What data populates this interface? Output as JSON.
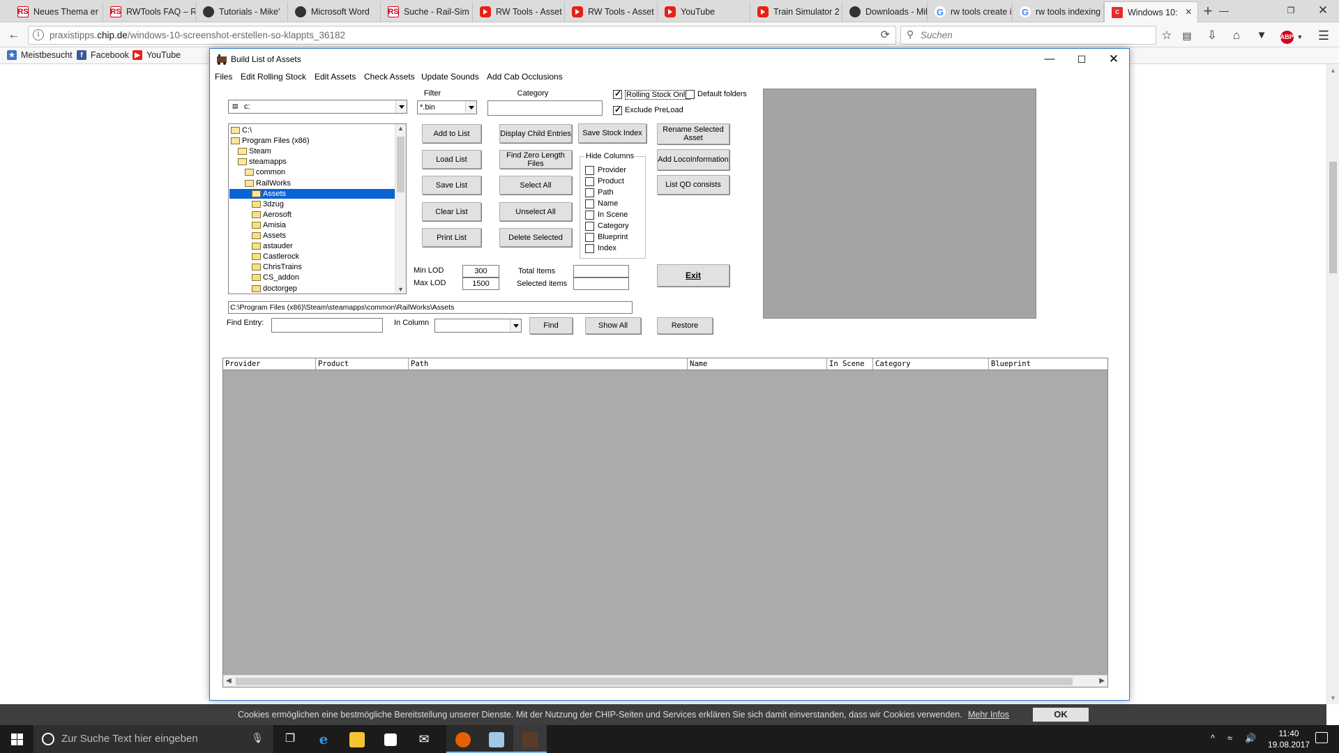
{
  "browser": {
    "tabs": [
      {
        "label": "Neues Thema er",
        "fav": "rs"
      },
      {
        "label": "RWTools FAQ – R",
        "fav": "rs"
      },
      {
        "label": "Tutorials - Mike'",
        "fav": "ns"
      },
      {
        "label": "Microsoft Word",
        "fav": "ns"
      },
      {
        "label": "Suche - Rail-Sim",
        "fav": "rs"
      },
      {
        "label": "RW Tools - Asset",
        "fav": "yt"
      },
      {
        "label": "RW Tools - Asset",
        "fav": "yt"
      },
      {
        "label": "YouTube",
        "fav": "yt"
      },
      {
        "label": "Train Simulator 2",
        "fav": "yt"
      },
      {
        "label": "Downloads - Mik",
        "fav": "ns"
      },
      {
        "label": "rw tools create in",
        "fav": "g"
      },
      {
        "label": "rw tools indexing",
        "fav": "g"
      },
      {
        "label": "Windows 10:",
        "fav": "win"
      }
    ],
    "url_prefix": "praxistipps.",
    "url_domain": "chip.de",
    "url_path": "/windows-10-screenshot-erstellen-so-klappts_36182",
    "search_placeholder": "Suchen",
    "bookmarks": [
      "Meistbesucht",
      "Facebook",
      "YouTube"
    ]
  },
  "cookie": {
    "text": "Cookies ermöglichen eine bestmögliche Bereitstellung unserer Dienste. Mit der Nutzung der CHIP-Seiten und Services erklären Sie sich damit einverstanden, dass wir Cookies verwenden.",
    "link": "Mehr Infos",
    "ok": "OK"
  },
  "taskbar": {
    "search_placeholder": "Zur Suche Text hier eingeben",
    "time": "11:40",
    "date": "19.08.2017"
  },
  "app": {
    "title": "Build List of Assets",
    "menu": [
      "Files",
      "Edit Rolling Stock",
      "Edit Assets",
      "Check Assets",
      "Update Sounds",
      "Add Cab Occlusions"
    ],
    "drive": "c:",
    "filter_label": "Filter",
    "filter_value": "*.bin",
    "category_label": "Category",
    "category_value": "",
    "rolling_stock_only": {
      "label": "Rolling Stock Only",
      "checked": true
    },
    "default_folders": {
      "label": "Default folders",
      "checked": false
    },
    "exclude_preload": {
      "label": "Exclude PreLoad",
      "checked": true
    },
    "tree": [
      {
        "label": "C:\\",
        "depth": 0,
        "open": true
      },
      {
        "label": "Program Files (x86)",
        "depth": 0,
        "open": true
      },
      {
        "label": "Steam",
        "depth": 1,
        "open": true
      },
      {
        "label": "steamapps",
        "depth": 1,
        "open": true
      },
      {
        "label": "common",
        "depth": 2,
        "open": true
      },
      {
        "label": "RailWorks",
        "depth": 2,
        "open": true
      },
      {
        "label": "Assets",
        "depth": 3,
        "open": true,
        "selected": true
      },
      {
        "label": "3dzug",
        "depth": 3
      },
      {
        "label": "Aerosoft",
        "depth": 3
      },
      {
        "label": "Amisia",
        "depth": 3
      },
      {
        "label": "Assets",
        "depth": 3
      },
      {
        "label": "astauder",
        "depth": 3
      },
      {
        "label": "Castlerock",
        "depth": 3
      },
      {
        "label": "ChrisTrains",
        "depth": 3
      },
      {
        "label": "CS_addon",
        "depth": 3
      },
      {
        "label": "doctorgep",
        "depth": 3
      }
    ],
    "buttons_col1": [
      "Add to List",
      "Load List",
      "Save List",
      "Clear List",
      "Print List"
    ],
    "buttons_col2": [
      "Display Child Entries",
      "Find Zero Length Files",
      "Select All",
      "Unselect All",
      "Delete Selected"
    ],
    "save_stock_index": "Save Stock Index",
    "buttons_col4": [
      "Rename Selected Asset",
      "Add LocoInformation",
      "List QD consists"
    ],
    "hide_columns_label": "Hide Columns",
    "hide_columns": [
      "Provider",
      "Product",
      "Path",
      "Name",
      "In Scene",
      "Category",
      "Blueprint",
      "Index"
    ],
    "min_lod_label": "Min LOD",
    "min_lod": "300",
    "max_lod_label": "Max LOD",
    "max_lod": "1500",
    "total_items_label": "Total Items",
    "total_items": "",
    "selected_items_label": "Selected items",
    "selected_items": "",
    "exit": "Exit",
    "path": "C:\\Program Files (x86)\\Steam\\steamapps\\common\\RailWorks\\Assets",
    "find_entry_label": "Find Entry:",
    "find_entry": "",
    "in_column_label": "In Column",
    "in_column": "",
    "find": "Find",
    "show_all": "Show All",
    "restore": "Restore",
    "grid_columns": [
      "Provider",
      "Product",
      "Path",
      "Name",
      "In Scene",
      "Category",
      "Blueprint"
    ]
  }
}
